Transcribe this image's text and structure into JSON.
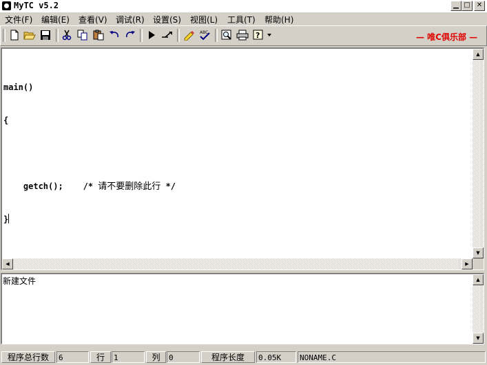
{
  "window": {
    "title": "MyTC v5.2",
    "min_glyph": "▁",
    "max_glyph": "□",
    "close_glyph": "✕"
  },
  "menu": {
    "items": [
      {
        "label": "文件(F)"
      },
      {
        "label": "编辑(E)"
      },
      {
        "label": "查看(V)"
      },
      {
        "label": "调试(R)"
      },
      {
        "label": "设置(S)"
      },
      {
        "label": "视图(L)"
      },
      {
        "label": "工具(T)"
      },
      {
        "label": "帮助(H)"
      }
    ]
  },
  "toolbar": {
    "brand": "—  唯C俱乐部  —",
    "icons": [
      "new-file-icon",
      "open-folder-icon",
      "save-icon",
      "cut-icon",
      "copy-icon",
      "paste-icon",
      "undo-icon",
      "redo-icon",
      "run-icon",
      "step-icon",
      "highlight-icon",
      "spell-check-icon",
      "preview-icon",
      "print-icon",
      "help-icon",
      "dropdown-icon"
    ],
    "brand_color": "#e00000"
  },
  "editor": {
    "lines": [
      "main()",
      "{",
      "",
      "    getch();    /* ",
      "}"
    ],
    "comment_cn": "请不要删除此行",
    "comment_end": " */"
  },
  "output": {
    "text": "新建文件"
  },
  "status": {
    "total_lines_label": "程序总行数",
    "total_lines_value": "6",
    "row_label": "行",
    "row_value": "1",
    "col_label": "列",
    "col_value": "0",
    "length_label": "程序长度",
    "length_value": "0.05K",
    "filename": "NONAME.C"
  }
}
